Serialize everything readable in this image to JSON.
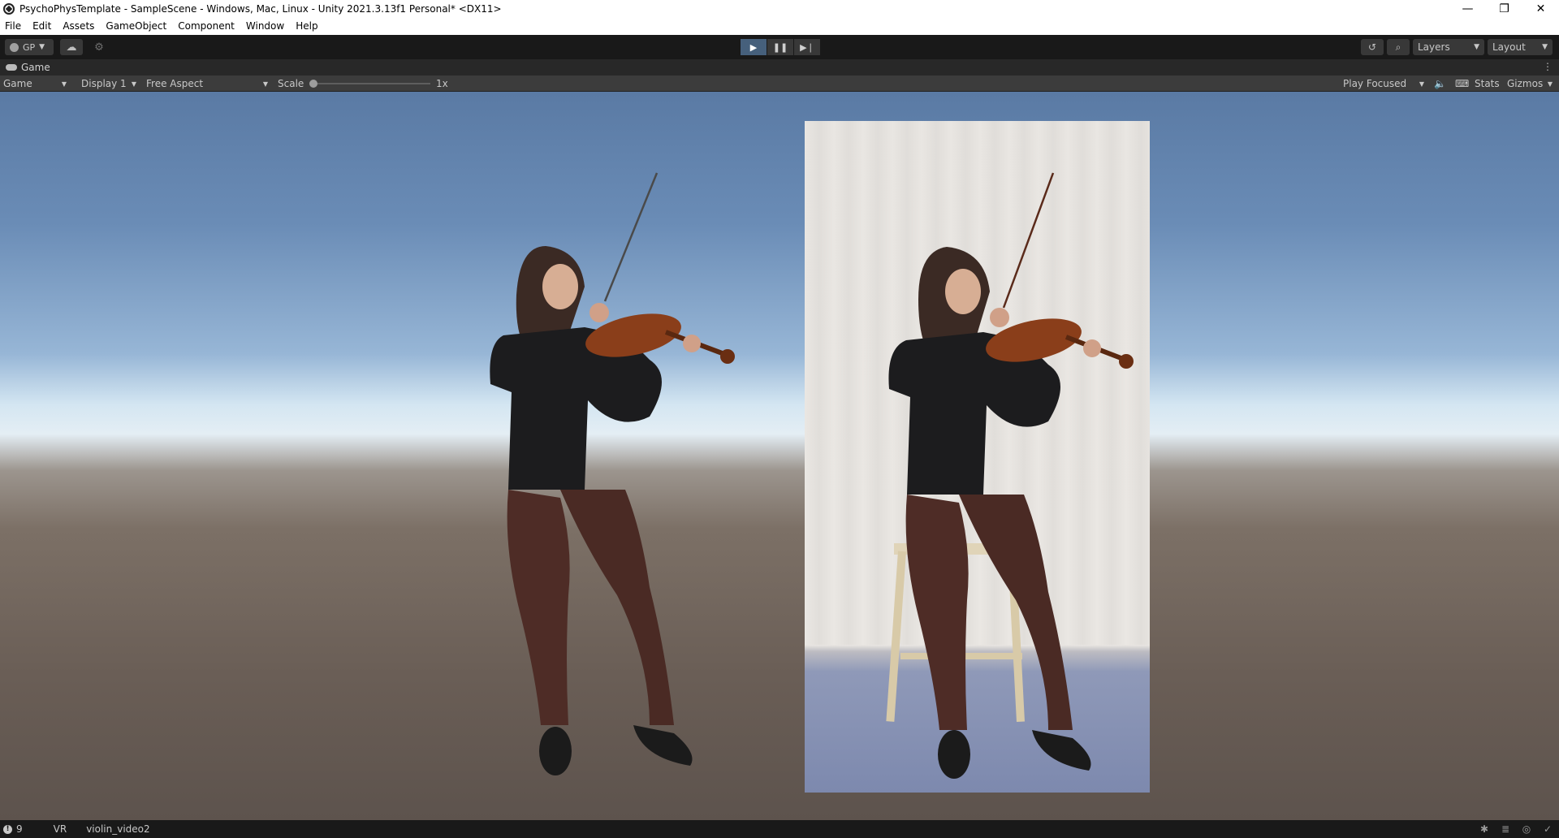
{
  "window": {
    "title": "PsychoPhysTemplate - SampleScene - Windows, Mac, Linux - Unity 2021.3.13f1 Personal* <DX11>",
    "controls": {
      "minimize": "—",
      "restore": "❐",
      "close": "✕"
    }
  },
  "menu": [
    "File",
    "Edit",
    "Assets",
    "GameObject",
    "Component",
    "Window",
    "Help"
  ],
  "toolbar": {
    "account_label": "GP",
    "layers_label": "Layers",
    "layout_label": "Layout",
    "play_active": true,
    "icons": [
      "account-icon",
      "cloud-icon",
      "settings-icon",
      "play-icon",
      "pause-icon",
      "step-icon",
      "history-icon",
      "search-icon"
    ]
  },
  "tab": {
    "label": "Game"
  },
  "game_toolbar": {
    "view_mode": "Game",
    "display": "Display 1",
    "aspect": "Free Aspect",
    "scale_label": "Scale",
    "scale_value": "1x",
    "play_focused": "Play Focused",
    "stats": "Stats",
    "gizmos": "Gizmos"
  },
  "status": {
    "count": "9",
    "vr_label": "VR",
    "scene_object": "violin_video2"
  },
  "colors": {
    "play_active": "#46607c",
    "sky_top": "#5a7aa4",
    "ground": "#6a5e56",
    "panel_bg": "#191919"
  }
}
